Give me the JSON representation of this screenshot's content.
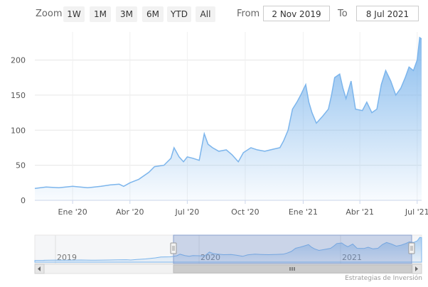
{
  "toolbar": {
    "zoom_label": "Zoom",
    "buttons": [
      "1W",
      "1M",
      "3M",
      "6M",
      "YTD",
      "All"
    ],
    "from_label": "From",
    "from_value": "2 Nov 2019",
    "to_label": "To",
    "to_value": "8 Jul 2021"
  },
  "credit": "Estrategias de Inversión",
  "colors": {
    "line": "#7cb5ec",
    "fill_top": "#7cb5ec",
    "navigator_mask": "#6685c2"
  },
  "chart_data": {
    "type": "area",
    "y_ticks": [
      0,
      50,
      100,
      150,
      200
    ],
    "ylim": [
      0,
      240
    ],
    "xlim": [
      "2019-11-02",
      "2021-07-08"
    ],
    "x_ticks": [
      {
        "date": "2020-01-01",
        "label": "Ene '20"
      },
      {
        "date": "2020-04-01",
        "label": "Abr '20"
      },
      {
        "date": "2020-07-01",
        "label": "Jul '20"
      },
      {
        "date": "2020-10-01",
        "label": "Oct '20"
      },
      {
        "date": "2021-01-01",
        "label": "Ene '21"
      },
      {
        "date": "2021-04-01",
        "label": "Abr '21"
      },
      {
        "date": "2021-07-01",
        "label": "Jul '21"
      }
    ],
    "series": [
      {
        "x": [
          "2019-11-02",
          "2019-11-20",
          "2019-12-10",
          "2020-01-01",
          "2020-01-25",
          "2020-02-15",
          "2020-03-01",
          "2020-03-15",
          "2020-03-22",
          "2020-04-01",
          "2020-04-15",
          "2020-05-01",
          "2020-05-10",
          "2020-05-25",
          "2020-06-05",
          "2020-06-10",
          "2020-06-18",
          "2020-06-25",
          "2020-07-01",
          "2020-07-10",
          "2020-07-20",
          "2020-07-28",
          "2020-08-03",
          "2020-08-10",
          "2020-08-20",
          "2020-09-01",
          "2020-09-10",
          "2020-09-20",
          "2020-09-28",
          "2020-10-10",
          "2020-10-20",
          "2020-11-01",
          "2020-11-15",
          "2020-11-25",
          "2020-12-01",
          "2020-12-08",
          "2020-12-15",
          "2020-12-22",
          "2020-12-28",
          "2021-01-05",
          "2021-01-10",
          "2021-01-15",
          "2021-01-22",
          "2021-02-01",
          "2021-02-10",
          "2021-02-15",
          "2021-02-20",
          "2021-02-28",
          "2021-03-05",
          "2021-03-10",
          "2021-03-18",
          "2021-03-25",
          "2021-04-05",
          "2021-04-12",
          "2021-04-20",
          "2021-04-28",
          "2021-05-05",
          "2021-05-12",
          "2021-05-20",
          "2021-05-28",
          "2021-06-05",
          "2021-06-12",
          "2021-06-18",
          "2021-06-25",
          "2021-07-01",
          "2021-07-05",
          "2021-07-08"
        ],
        "values": [
          17,
          19,
          18,
          20,
          18,
          20,
          22,
          23,
          20,
          25,
          30,
          40,
          48,
          50,
          60,
          75,
          62,
          55,
          62,
          60,
          57,
          95,
          80,
          75,
          70,
          72,
          65,
          55,
          68,
          75,
          72,
          70,
          73,
          75,
          85,
          100,
          130,
          140,
          150,
          165,
          140,
          125,
          110,
          120,
          130,
          150,
          175,
          180,
          160,
          145,
          170,
          130,
          128,
          140,
          125,
          130,
          165,
          185,
          170,
          150,
          160,
          175,
          190,
          185,
          200,
          232,
          230
        ]
      }
    ]
  }
}
